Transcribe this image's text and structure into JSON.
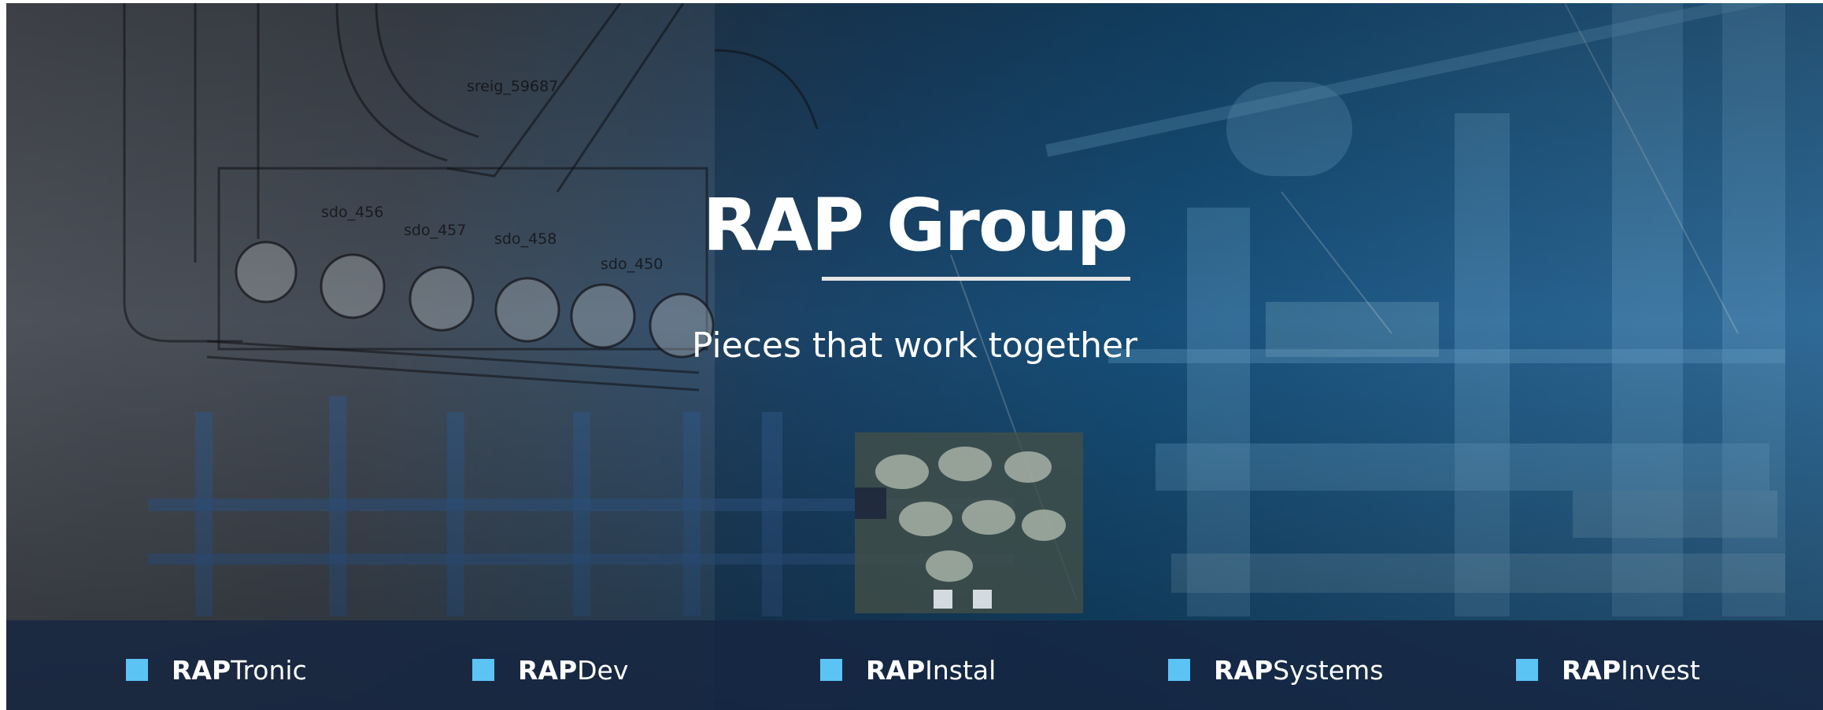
{
  "hero": {
    "title": "RAP Group",
    "subtitle": "Pieces that work together",
    "blueprint_labels": [
      "sreig_59687",
      "sdo_456",
      "sdo_457",
      "sdo_458",
      "sdo_450"
    ]
  },
  "brands": [
    {
      "prefix": "RAP",
      "suffix": "Tronic"
    },
    {
      "prefix": "RAP",
      "suffix": "Dev"
    },
    {
      "prefix": "RAP",
      "suffix": "Instal"
    },
    {
      "prefix": "RAP",
      "suffix": "Systems"
    },
    {
      "prefix": "RAP",
      "suffix": "Invest"
    }
  ],
  "colors": {
    "accent": "#5cc3f5",
    "bar": "#162642",
    "text": "#ffffff"
  },
  "icons": {
    "brand_bullet": "square-bullet-icon"
  }
}
